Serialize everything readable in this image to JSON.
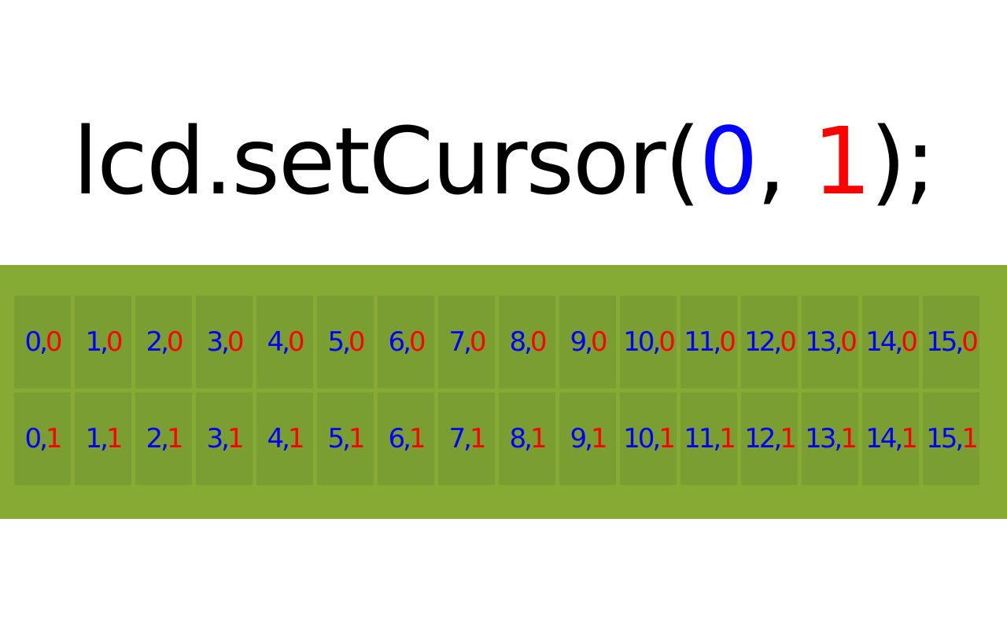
{
  "code": {
    "prefix": "lcd.setCursor(",
    "col_arg": "0",
    "comma": ", ",
    "row_arg": "1",
    "suffix": ");"
  },
  "colors": {
    "column": "#0000ff",
    "row": "#ff0000",
    "text": "#000000",
    "lcd_background": "#86aa33",
    "cell_background": "#7a9e31"
  },
  "lcd": {
    "rows": [
      {
        "cells": [
          {
            "col": "0",
            "sep": ",",
            "row": "0"
          },
          {
            "col": "1",
            "sep": ",",
            "row": "0"
          },
          {
            "col": "2",
            "sep": ",",
            "row": "0"
          },
          {
            "col": "3",
            "sep": ",",
            "row": "0"
          },
          {
            "col": "4",
            "sep": ",",
            "row": "0"
          },
          {
            "col": "5",
            "sep": ",",
            "row": "0"
          },
          {
            "col": "6",
            "sep": ",",
            "row": "0"
          },
          {
            "col": "7",
            "sep": ",",
            "row": "0"
          },
          {
            "col": "8",
            "sep": ",",
            "row": "0"
          },
          {
            "col": "9",
            "sep": ",",
            "row": "0"
          },
          {
            "col": "10",
            "sep": ",",
            "row": "0"
          },
          {
            "col": "11",
            "sep": ",",
            "row": "0"
          },
          {
            "col": "12",
            "sep": ",",
            "row": "0"
          },
          {
            "col": "13",
            "sep": ",",
            "row": "0"
          },
          {
            "col": "14",
            "sep": ",",
            "row": "0"
          },
          {
            "col": "15",
            "sep": ",",
            "row": "0"
          }
        ]
      },
      {
        "cells": [
          {
            "col": "0",
            "sep": ",",
            "row": "1"
          },
          {
            "col": "1",
            "sep": ",",
            "row": "1"
          },
          {
            "col": "2",
            "sep": ",",
            "row": "1"
          },
          {
            "col": "3",
            "sep": ",",
            "row": "1"
          },
          {
            "col": "4",
            "sep": ",",
            "row": "1"
          },
          {
            "col": "5",
            "sep": ",",
            "row": "1"
          },
          {
            "col": "6",
            "sep": ",",
            "row": "1"
          },
          {
            "col": "7",
            "sep": ",",
            "row": "1"
          },
          {
            "col": "8",
            "sep": ",",
            "row": "1"
          },
          {
            "col": "9",
            "sep": ",",
            "row": "1"
          },
          {
            "col": "10",
            "sep": ",",
            "row": "1"
          },
          {
            "col": "11",
            "sep": ",",
            "row": "1"
          },
          {
            "col": "12",
            "sep": ",",
            "row": "1"
          },
          {
            "col": "13",
            "sep": ",",
            "row": "1"
          },
          {
            "col": "14",
            "sep": ",",
            "row": "1"
          },
          {
            "col": "15",
            "sep": ",",
            "row": "1"
          }
        ]
      }
    ]
  }
}
